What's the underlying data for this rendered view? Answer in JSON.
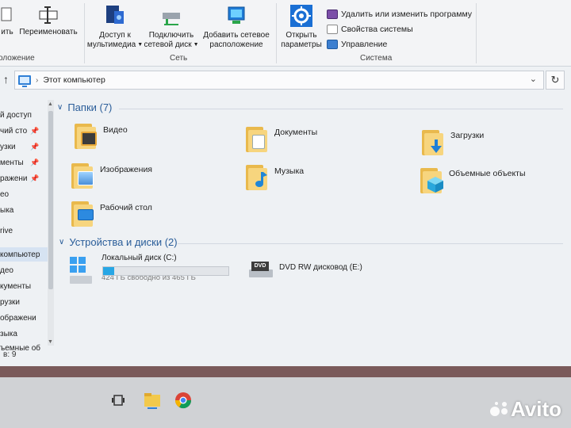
{
  "ribbon": {
    "location_group": {
      "label": "оложение",
      "buttons": [
        {
          "label": "ить"
        },
        {
          "label": "Переименовать"
        }
      ]
    },
    "network_group": {
      "label": "Сеть",
      "buttons": [
        {
          "label": "Доступ к мультимедиа",
          "has_menu": true
        },
        {
          "label": "Подключить сетевой диск",
          "has_menu": true
        },
        {
          "label": "Добавить сетевое расположение"
        }
      ]
    },
    "system_group": {
      "label": "Система",
      "open_params_label": "Открыть параметры",
      "items": [
        {
          "label": "Удалить или изменить программу"
        },
        {
          "label": "Свойства системы"
        },
        {
          "label": "Управление"
        }
      ]
    }
  },
  "address_bar": {
    "path": "Этот компьютер"
  },
  "nav_pane": {
    "items": [
      {
        "label": "й доступ",
        "pinned": false,
        "selected": false
      },
      {
        "label": "чий сто",
        "pinned": true,
        "selected": false
      },
      {
        "label": "узки",
        "pinned": true,
        "selected": false
      },
      {
        "label": "менты",
        "pinned": true,
        "selected": false
      },
      {
        "label": "ражени",
        "pinned": true,
        "selected": false
      },
      {
        "label": "ео",
        "pinned": false,
        "selected": false
      },
      {
        "label": "ыка",
        "pinned": false,
        "selected": false
      },
      {
        "label": "rive",
        "pinned": false,
        "selected": false
      },
      {
        "label": "компьютер",
        "pinned": false,
        "selected": true
      },
      {
        "label": "део",
        "pinned": false,
        "selected": false
      },
      {
        "label": "кументы",
        "pinned": false,
        "selected": false
      },
      {
        "label": "рузки",
        "pinned": false,
        "selected": false
      },
      {
        "label": "ображени",
        "pinned": false,
        "selected": false
      },
      {
        "label": "зыка",
        "pinned": false,
        "selected": false
      },
      {
        "label": "ъемные об",
        "pinned": false,
        "selected": false
      }
    ],
    "status": "в: 9"
  },
  "folders_section": {
    "title": "Папки (7)",
    "folders": [
      {
        "name": "Видео",
        "icon": "video-folder-icon"
      },
      {
        "name": "Документы",
        "icon": "documents-folder-icon"
      },
      {
        "name": "Загрузки",
        "icon": "downloads-folder-icon"
      },
      {
        "name": "Изображения",
        "icon": "pictures-folder-icon"
      },
      {
        "name": "Музыка",
        "icon": "music-folder-icon"
      },
      {
        "name": "Объемные объекты",
        "icon": "3d-objects-folder-icon"
      },
      {
        "name": "Рабочий стол",
        "icon": "desktop-folder-icon"
      }
    ]
  },
  "drives_section": {
    "title": "Устройства и диски (2)",
    "drives": [
      {
        "name": "Локальный диск (C:)",
        "space": "424 ГБ свободно из 465 ГБ",
        "used_fraction": 0.088
      },
      {
        "name": "DVD RW дисковод (E:)",
        "badge": "DVD"
      }
    ]
  },
  "colors": {
    "accent": "#2a5d99",
    "usage_bar": "#27a6e5",
    "folder": "#f7d57e"
  },
  "watermark": "Avito"
}
